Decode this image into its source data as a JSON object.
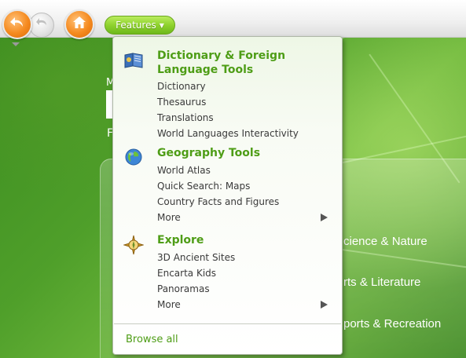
{
  "toolbar": {
    "back_icon": "back-arrow-icon",
    "forward_icon": "forward-arrow-icon",
    "home_icon": "home-icon",
    "features_label": "Features",
    "features_caret": "▼"
  },
  "background": {
    "letter_m": "M",
    "letter_f": "F",
    "categories": [
      "cience & Nature",
      "rts & Literature",
      "ports & Recreation"
    ]
  },
  "menu": {
    "sections": [
      {
        "title": "Dictionary & Foreign Language Tools",
        "icon": "dictionary-book-icon",
        "items": [
          "Dictionary",
          "Thesaurus",
          "Translations",
          "World Languages Interactivity"
        ]
      },
      {
        "title": "Geography Tools",
        "icon": "globe-icon",
        "items": [
          "World Atlas",
          "Quick Search: Maps",
          "Country Facts and Figures",
          "More"
        ]
      },
      {
        "title": "Explore",
        "icon": "compass-icon",
        "items": [
          "3D Ancient Sites",
          "Encarta Kids",
          "Panoramas",
          "More"
        ]
      }
    ],
    "browse_all": "Browse all"
  },
  "colors": {
    "accent_green": "#4e9d16",
    "button_orange": "#f58a1f",
    "features_green": "#8fd22e",
    "background_green": "#3c8d20"
  }
}
